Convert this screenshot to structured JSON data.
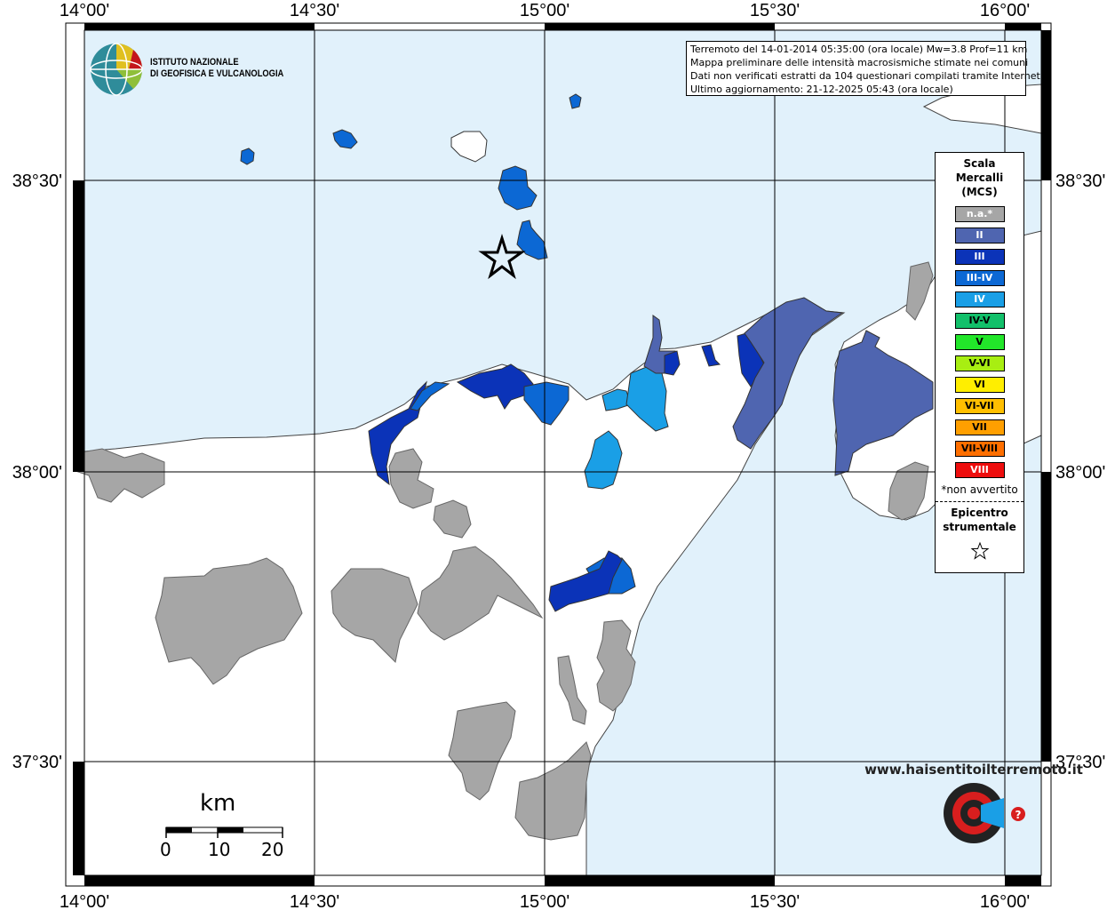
{
  "map": {
    "x_ticks": [
      "14°00'",
      "14°30'",
      "15°00'",
      "15°30'",
      "16°00'"
    ],
    "y_ticks": [
      "38°30'",
      "38°00'",
      "37°30'"
    ],
    "sea_color": "#e1f1fb",
    "land_color": "#ffffff",
    "na_color": "#a6a6a6"
  },
  "info": {
    "line1": "Terremoto del 14-01-2014 05:35:00 (ora locale) Mw=3.8 Prof=11 km",
    "line2": "Mappa preliminare delle intensità macrosismiche stimate nei comuni",
    "line3": "Dati non verificati estratti da 104 questionari compilati tramite Internet.",
    "line4": "Ultimo aggiornamento: 21-12-2025 05:43 (ora locale)"
  },
  "logo": {
    "line1": "ISTITUTO NAZIONALE",
    "line2": "DI GEOFISICA E VULCANOLOGIA"
  },
  "legend": {
    "title_1": "Scala",
    "title_2": "Mercalli",
    "title_3": "(MCS)",
    "items": [
      {
        "label": "n.a.*",
        "color": "#a6a6a6",
        "text_color": "#ffffff"
      },
      {
        "label": "II",
        "color": "#4f65b0",
        "text_color": "#ffffff"
      },
      {
        "label": "III",
        "color": "#0b33b8",
        "text_color": "#ffffff"
      },
      {
        "label": "III-IV",
        "color": "#0c68d4",
        "text_color": "#ffffff"
      },
      {
        "label": "IV",
        "color": "#1a9fe6",
        "text_color": "#ffffff"
      },
      {
        "label": "IV-V",
        "color": "#12c06a",
        "text_color": "#000000"
      },
      {
        "label": "V",
        "color": "#22e62a",
        "text_color": "#000000"
      },
      {
        "label": "V-VI",
        "color": "#a8ee12",
        "text_color": "#000000"
      },
      {
        "label": "VI",
        "color": "#ffee00",
        "text_color": "#000000"
      },
      {
        "label": "VI-VII",
        "color": "#ffbf00",
        "text_color": "#000000"
      },
      {
        "label": "VII",
        "color": "#ff9f00",
        "text_color": "#000000"
      },
      {
        "label": "VII-VIII",
        "color": "#ff6f00",
        "text_color": "#000000"
      },
      {
        "label": "VIII",
        "color": "#ee0e0e",
        "text_color": "#ffffff"
      }
    ],
    "note": "*non avvertito",
    "epicenter_1": "Epicentro",
    "epicenter_2": "strumentale"
  },
  "scalebar": {
    "unit": "km",
    "ticks": [
      "0",
      "10",
      "20"
    ]
  },
  "watermark": {
    "text": "www.haisentitoilterremoto.it"
  }
}
